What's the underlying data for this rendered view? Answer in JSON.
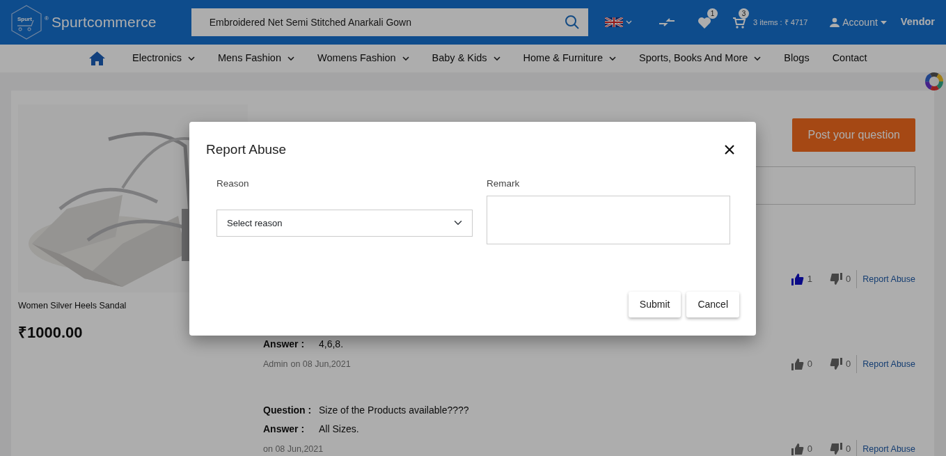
{
  "header": {
    "logo": {
      "badge_text": "Spurt",
      "registered": "®",
      "brand": "Spurtcommerce"
    },
    "search": {
      "value": "Embroidered Net Semi Stitched Anarkali Gown"
    },
    "wishlist_count": "1",
    "cart_count": "3",
    "cart_summary": "3 items : ₹ 4717",
    "account": "Account",
    "vendor": "Vendor"
  },
  "nav": {
    "items": [
      {
        "label": "Electronics",
        "dropdown": true
      },
      {
        "label": "Mens Fashion",
        "dropdown": true
      },
      {
        "label": "Womens Fashion",
        "dropdown": true
      },
      {
        "label": "Baby & Kids",
        "dropdown": true
      },
      {
        "label": "Home & Furniture",
        "dropdown": true
      },
      {
        "label": "Sports, Books And More",
        "dropdown": true
      },
      {
        "label": "Blogs",
        "dropdown": false
      },
      {
        "label": "Contact",
        "dropdown": false
      }
    ]
  },
  "product": {
    "name": "Women Silver Heels Sandal",
    "price": "₹1000.00"
  },
  "questions": {
    "post_button": "Post your question",
    "items": [
      {
        "likes": "1",
        "liked": true,
        "dislikes": "0",
        "report": "Report Abuse"
      },
      {
        "answer_label": "Answer :",
        "answer": "4,6,8.",
        "author": "Admin",
        "date": "on 08 Jun,2021",
        "likes": "0",
        "liked": false,
        "dislikes": "0",
        "report": "Report Abuse"
      },
      {
        "question_label": "Question :",
        "question": "Size of the Products available????",
        "answer_label": "Answer :",
        "answer": "All Sizes.",
        "date": "on 08 Jun,2021",
        "likes": "0",
        "liked": false,
        "dislikes": "0",
        "report": "Report Abuse"
      }
    ]
  },
  "modal": {
    "title": "Report Abuse",
    "reason_label": "Reason",
    "reason_value": "Select reason",
    "remark_label": "Remark",
    "buttons": [
      "Submit",
      "Cancel"
    ]
  }
}
